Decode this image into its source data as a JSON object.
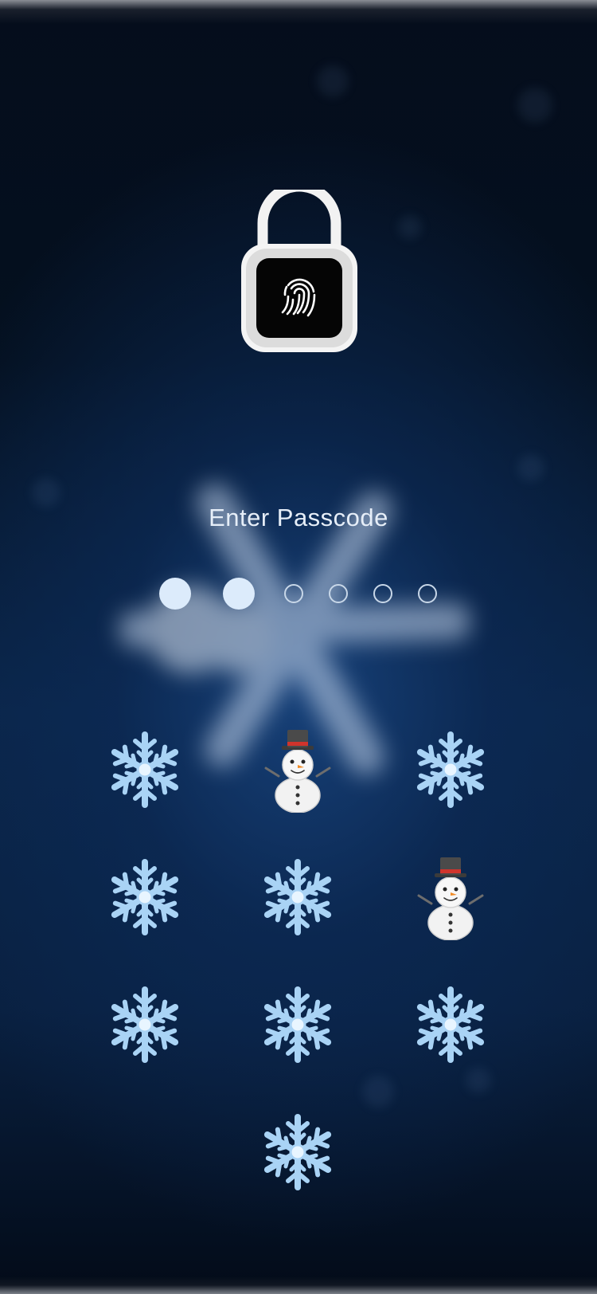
{
  "lock_screen": {
    "prompt": "Enter Passcode",
    "icon": "fingerprint-lock-icon",
    "passcode": {
      "length": 6,
      "entered": 2
    }
  },
  "keypad": {
    "keys": [
      {
        "icon": "snowflake-icon"
      },
      {
        "icon": "snowman-icon"
      },
      {
        "icon": "snowflake-icon"
      },
      {
        "icon": "snowflake-icon"
      },
      {
        "icon": "snowflake-icon"
      },
      {
        "icon": "snowman-icon"
      },
      {
        "icon": "snowflake-icon"
      },
      {
        "icon": "snowflake-icon"
      },
      {
        "icon": "snowflake-icon"
      },
      {
        "icon": "snowflake-icon"
      }
    ]
  },
  "colors": {
    "accent": "#dcebfb",
    "background": "#0a2548",
    "snowflake": "#a9d3f5"
  }
}
